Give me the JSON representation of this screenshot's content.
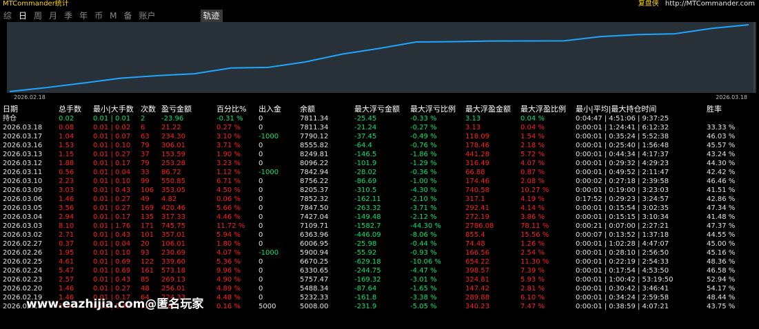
{
  "app": {
    "title": "MTCommander统计",
    "brand_label": "复盘侠",
    "brand_url": "http://MTCommander.com"
  },
  "tabs": [
    {
      "label": "综",
      "active": false
    },
    {
      "label": "日",
      "active": true
    },
    {
      "label": "周",
      "active": false
    },
    {
      "label": "月",
      "active": false
    },
    {
      "label": "季",
      "active": false
    },
    {
      "label": "年",
      "active": false
    },
    {
      "label": "币",
      "active": false
    },
    {
      "label": "M",
      "active": false
    },
    {
      "label": "备",
      "active": false
    },
    {
      "label": "账户",
      "active": false
    }
  ],
  "trace_tab": "轨迹",
  "chart_data": {
    "type": "line",
    "x_start": "2026.02.18",
    "x_end": "2026.03.18",
    "x": [
      "2026.02.18",
      "2026.02.19",
      "2026.02.20",
      "2026.02.23",
      "2026.02.24",
      "2026.02.25",
      "2026.02.26",
      "2026.02.27",
      "2026.03.02",
      "2026.03.03",
      "2026.03.04",
      "2026.03.05",
      "2026.03.06",
      "2026.03.09",
      "2026.03.10",
      "2026.03.11",
      "2026.03.12",
      "2026.03.13",
      "2026.03.16",
      "2026.03.17",
      "2026.03.18"
    ],
    "values": [
      5008.0,
      5232.33,
      5488.34,
      5757.47,
      6330.65,
      6670.25,
      5900.94,
      6006.95,
      6363.96,
      7109.71,
      7427.04,
      7847.5,
      7852.32,
      8205.37,
      8756.22,
      7842.94,
      8096.22,
      8249.81,
      8555.82,
      7790.12,
      7811.34
    ],
    "line_color": "#1fa6ff",
    "grid": false
  },
  "table": {
    "headers": [
      "日期",
      "总手数",
      "最小|大手数",
      "次数",
      "盈亏金额",
      "百分比%",
      "出入金",
      "余额",
      "最大浮亏金额",
      "最大浮亏比例",
      "最大浮盈金额",
      "最大浮盈比例",
      "最小|平均|最大持仓时间",
      "胜率"
    ],
    "totals": [
      "持仓",
      "0.02",
      "0.01 | 0.01",
      "2",
      "-23.96",
      "-0.31 %",
      "0",
      "7811.34",
      "-25.45",
      "-0.33 %",
      "3.13",
      "0.04 %",
      "0:04:47 | 4:51:06 | 9:37:25",
      ""
    ],
    "rows": [
      [
        "2026.03.18",
        "0.08",
        "0.01 | 0.02",
        "6",
        "21.22",
        "0.27 %",
        "0",
        "7811.34",
        "-21.24",
        "-0.27 %",
        "3.13",
        "0.04 %",
        "0:00:01 | 1:24:41 | 6:12:32",
        "33.33 %"
      ],
      [
        "2026.03.17",
        "1.04",
        "0.01 | 0.07",
        "63",
        "234.30",
        "3.10 %",
        "-1000",
        "7790.12",
        "-37.45",
        "-0.49 %",
        "118.09",
        "1.54 %",
        "0:00:01 | 0:35:24 | 5:52:38",
        "46.03 %"
      ],
      [
        "2026.03.16",
        "1.53",
        "0.01 | 0.10",
        "79",
        "306.01",
        "3.71 %",
        "0",
        "8555.82",
        "-64.4",
        "-0.76 %",
        "178.46",
        "2.18 %",
        "0:00:01 | 0:25:40 | 1:56:48",
        "45.57 %"
      ],
      [
        "2026.03.13",
        "1.15",
        "0.01 | 0.27",
        "37",
        "153.59",
        "1.90 %",
        "0",
        "8249.81",
        "-146.5",
        "-1.86 %",
        "441.28",
        "5.72 %",
        "0:00:01 | 0:44:34 | 4:17:37",
        "43.24 %"
      ],
      [
        "2026.03.12",
        "1.88",
        "0.01 | 0.17",
        "79",
        "253.28",
        "3.23 %",
        "0",
        "8096.22",
        "-101.9",
        "-1.29 %",
        "316.49",
        "4.07 %",
        "0:00:01 | 0:29:32 | 4:29:23",
        "44.30 %"
      ],
      [
        "2026.03.11",
        "0.56",
        "0.01 | 0.04",
        "33",
        "86.72",
        "1.12 %",
        "-1000",
        "7842.94",
        "-28.02",
        "-0.36 %",
        "66.88",
        "0.87 %",
        "0:00:01 | 0:49:52 | 2:11:47",
        "42.42 %"
      ],
      [
        "2026.03.10",
        "2.23",
        "0.01 | 0.10",
        "99",
        "550.85",
        "6.71 %",
        "0",
        "8756.22",
        "-86.69",
        "-1.00 %",
        "174.46",
        "2.08 %",
        "0:00:02 | 0:27:18 | 2:39:58",
        "46.46 %"
      ],
      [
        "2026.03.09",
        "3.03",
        "0.01 | 0.43",
        "106",
        "353.05",
        "4.50 %",
        "0",
        "8205.37",
        "-310.5",
        "-4.30 %",
        "740.58",
        "10.27 %",
        "0:00:01 | 0:19:00 | 3:23:03",
        "41.51 %"
      ],
      [
        "2026.03.06",
        "1.46",
        "0.01 | 0.27",
        "49",
        "4.82",
        "0.06 %",
        "0",
        "7852.32",
        "-162.11",
        "-2.10 %",
        "317.1",
        "4.19 %",
        "0:17:52 | 0:29:23 | 3:24:57",
        "42.86 %"
      ],
      [
        "2026.03.05",
        "3.56",
        "0.01 | 0.27",
        "169",
        "420.46",
        "5.66 %",
        "0",
        "7847.50",
        "-263.32",
        "-3.71 %",
        "292.41",
        "4.14 %",
        "0:00:01 | 0:15:54 | 3:02:35",
        "47.34 %"
      ],
      [
        "2026.03.04",
        "2.94",
        "0.01 | 0.17",
        "135",
        "317.33",
        "4.46 %",
        "0",
        "7427.04",
        "-149.48",
        "-2.12 %",
        "272.19",
        "3.86 %",
        "0:00:01 | 0:15:15 | 3:10:34",
        "41.48 %"
      ],
      [
        "2026.03.03",
        "8.10",
        "0.01 | 1.76",
        "171",
        "745.75",
        "11.72 %",
        "0",
        "7109.71",
        "-1582.7",
        "-44.30 %",
        "2786.08",
        "78.11 %",
        "0:00:21 | 0:07:00 | 2:27:21",
        "47.37 %"
      ],
      [
        "2026.03.02",
        "2.71",
        "0.01 | 0.43",
        "101",
        "357.01",
        "5.94 %",
        "0",
        "6363.96",
        "-446.09",
        "-8.06 %",
        "855.4",
        "15.56 %",
        "0:00:07 | 0:13:52 | 1:37:18",
        "44.55 %"
      ],
      [
        "2026.02.27",
        "0.37",
        "0.01 | 0.04",
        "20",
        "106.01",
        "1.80 %",
        "0",
        "6006.95",
        "-25.98",
        "-0.44 %",
        "74.48",
        "1.26 %",
        "0:00:01 | 1:02:28 | 4:47:07",
        "45.00 %"
      ],
      [
        "2026.02.26",
        "1.95",
        "0.01 | 0.10",
        "93",
        "230.69",
        "4.07 %",
        "-1000",
        "5900.94",
        "-55.92",
        "-0.93 %",
        "166.56",
        "2.54 %",
        "0:00:01 | 0:28:10 | 2:56:50",
        "45.16 %"
      ],
      [
        "2026.02.25",
        "4.61",
        "0.01 | 0.69",
        "122",
        "339.60",
        "5.36 %",
        "0",
        "6670.25",
        "-629.18",
        "-10.06 %",
        "654.22",
        "11.30 %",
        "0:00:01 | 0:22:19 | 2:54:33",
        "48.36 %"
      ],
      [
        "2026.02.24",
        "5.47",
        "0.01 | 0.69",
        "161",
        "573.18",
        "9.96 %",
        "0",
        "6330.65",
        "-244.75",
        "-4.47 %",
        "398.57",
        "7.39 %",
        "0:00:01 | 0:17:54 | 4:53:50",
        "46.58 %"
      ],
      [
        "2026.02.23",
        "2.57",
        "0.01 | 0.43",
        "85",
        "269.13",
        "4.90 %",
        "0",
        "5757.47",
        "-169.32",
        "-3.01 %",
        "324.81",
        "5.93 %",
        "0:00:01 | 1:00:42 | 53:19:50",
        "52.94 %"
      ],
      [
        "2026.02.20",
        "1.46",
        "0.01 | 0.27",
        "48",
        "256.01",
        "4.89 %",
        "0",
        "5488.34",
        "-87.64",
        "-1.65 %",
        "147.42",
        "2.81 %",
        "0:00:01 | 0:30:42 | 3:46:41",
        "54.17 %"
      ],
      [
        "2026.02.19",
        "1.46",
        "0.01 | 0.17",
        "64",
        "224.33",
        "4.48 %",
        "0",
        "5232.33",
        "-161.8",
        "-3.38 %",
        "289.88",
        "6.10 %",
        "0:00:01 | 0:34:24 | 2:59:58",
        "48.44 %"
      ],
      [
        "2026.02.18",
        "1.44",
        "0.01 | 0.43",
        "32",
        "8.00",
        "0.16 %",
        "5000",
        "5008.00",
        "-231.9",
        "-5.05 %",
        "340.23",
        "7.47 %",
        "0:00:01 | 0:38:59 | 4:07:21",
        "43.75 %"
      ]
    ]
  },
  "watermark": "www.eazhijia.com@匿名玩家"
}
